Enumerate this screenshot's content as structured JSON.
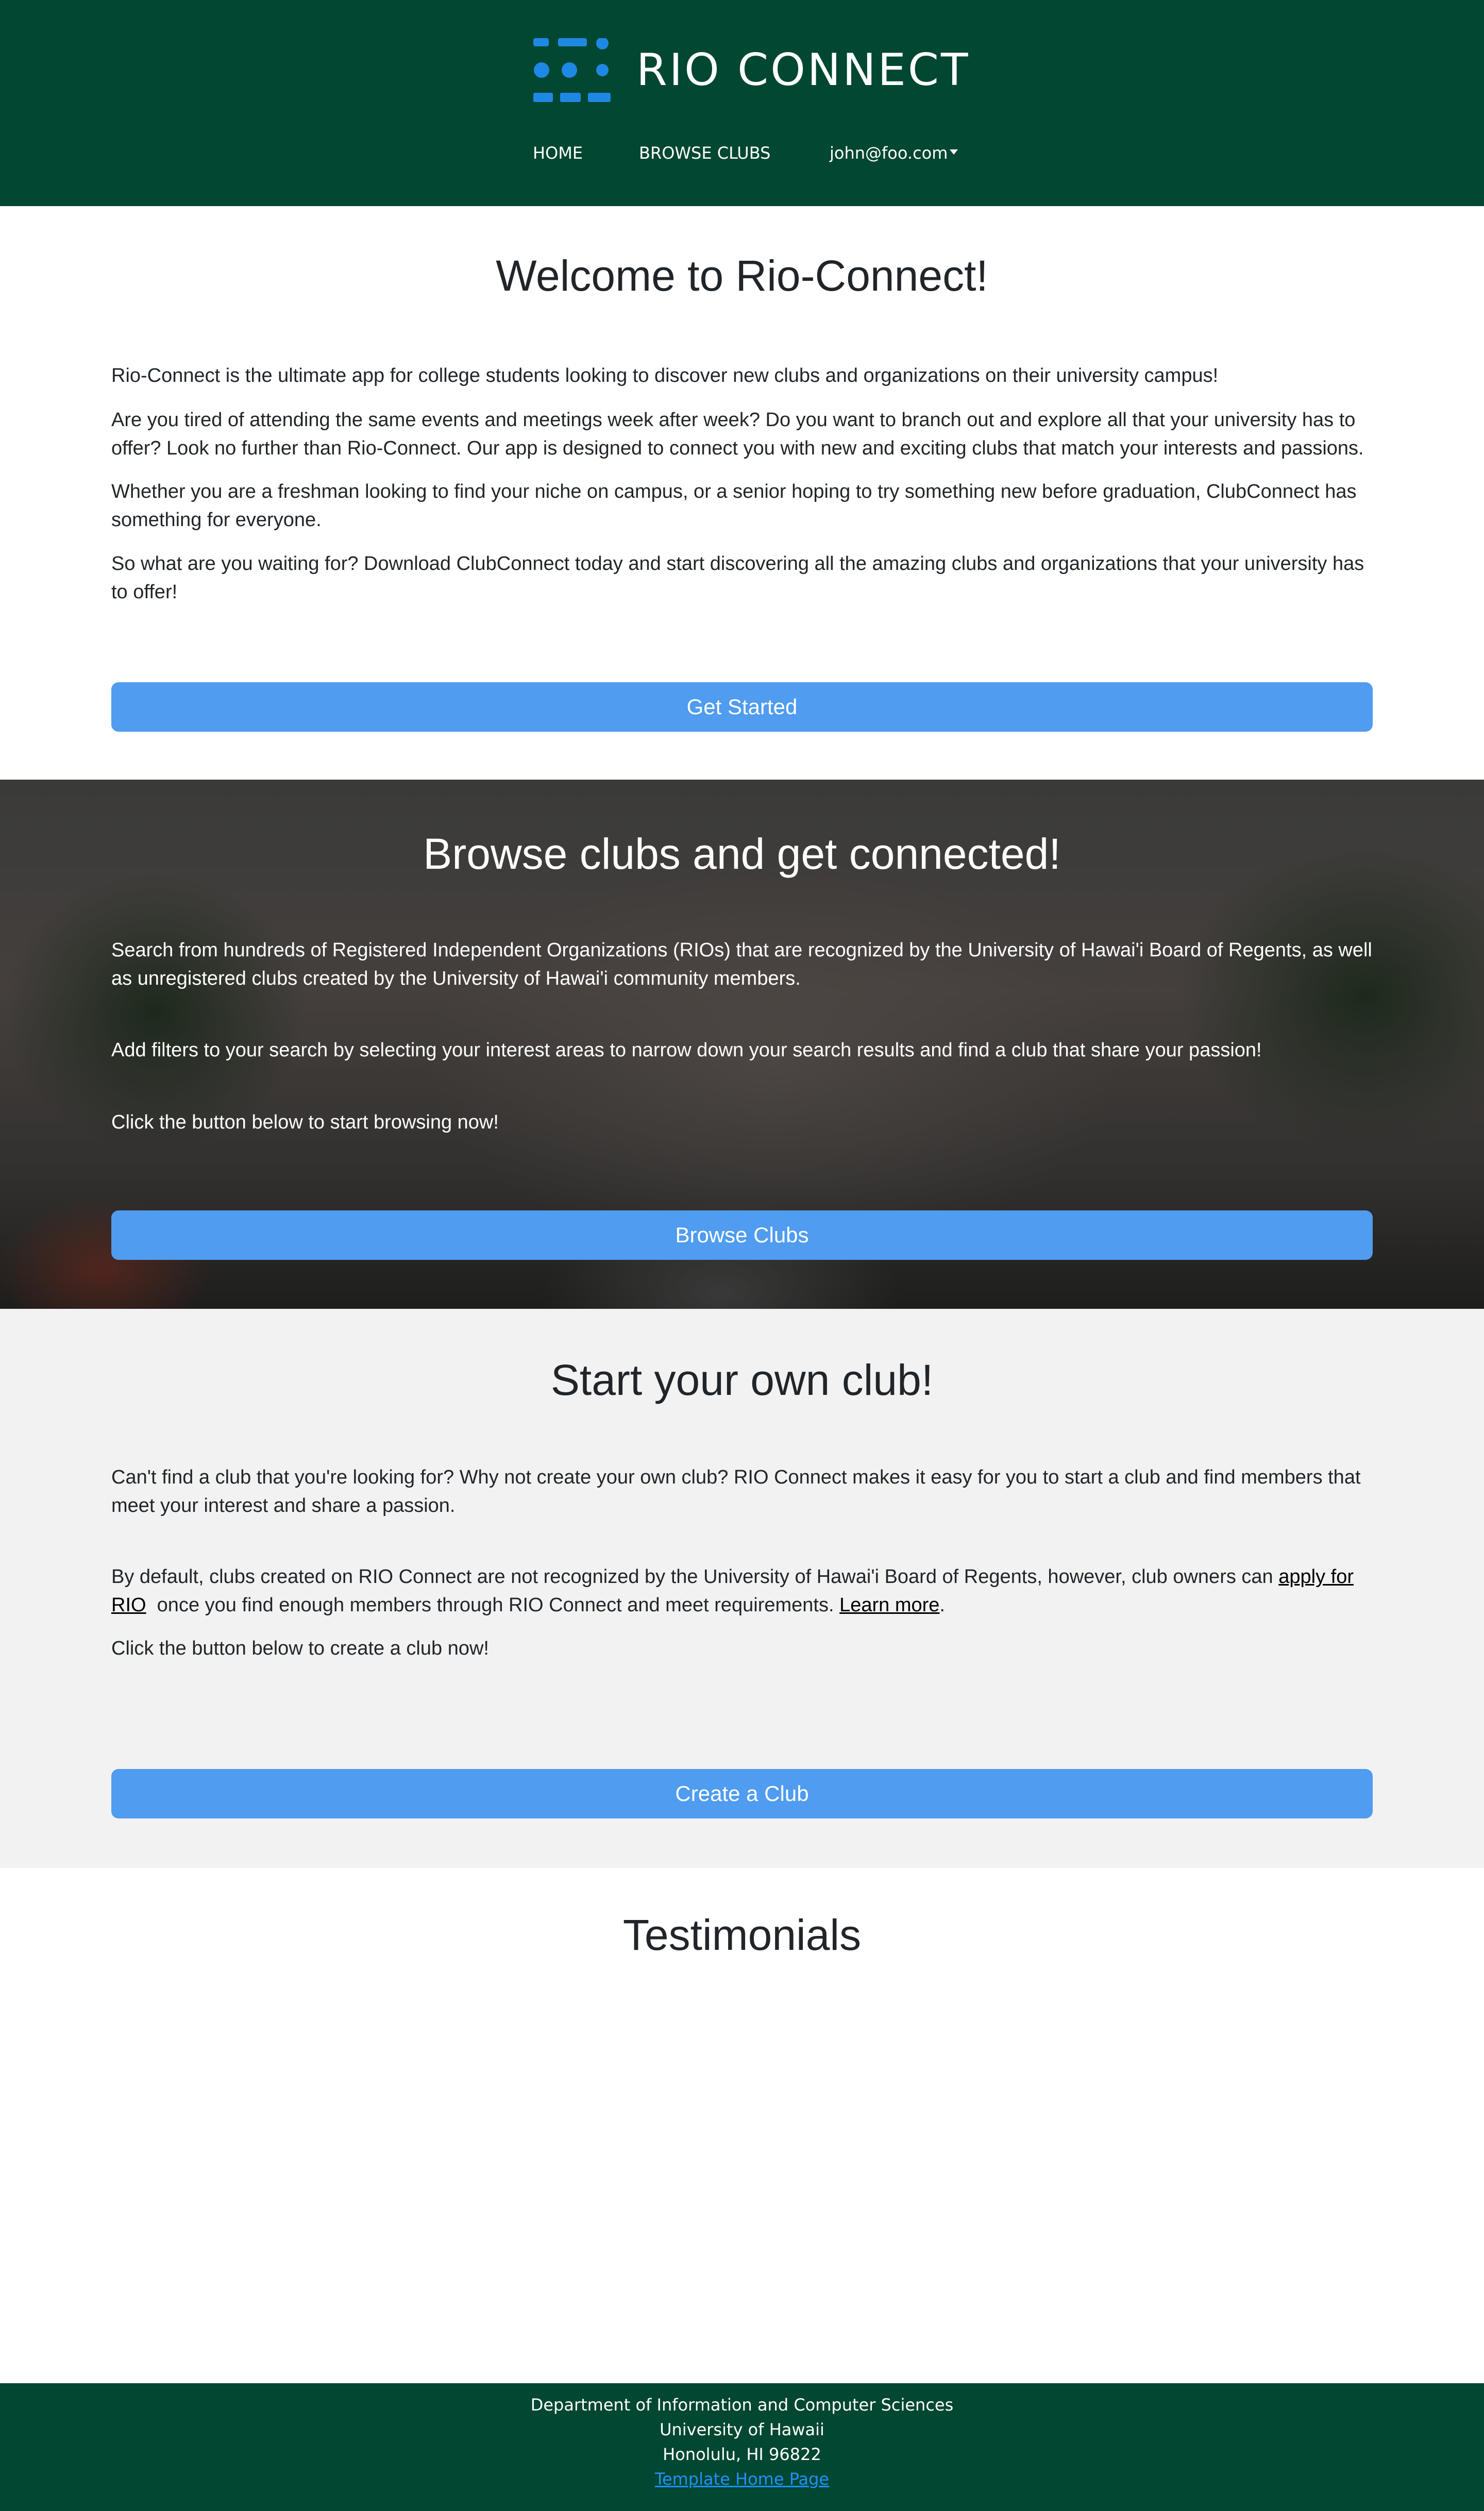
{
  "navbar": {
    "brand": "RIO CONNECT",
    "logo_icon": "rio-connect-logo-icon",
    "links": {
      "home": "HOME",
      "browse": "BROWSE CLUBS",
      "user": "john@foo.com"
    },
    "colors": {
      "background": "#024731",
      "text": "#ffffff",
      "logo": "#1e88e5"
    }
  },
  "welcome": {
    "title": "Welcome to Rio-Connect!",
    "paragraphs": [
      "Rio-Connect is the ultimate app for college students looking to discover new clubs and organizations on their university campus!",
      "Are you tired of attending the same events and meetings week after week? Do you want to branch out and explore all that your university has to offer? Look no further than Rio-Connect. Our app is designed to connect you with new and exciting clubs that match your interests and passions.",
      "Whether you are a freshman looking to find your niche on campus, or a senior hoping to try something new before graduation, ClubConnect has something for everyone.",
      "So what are you waiting for? Download ClubConnect today and start discovering all the amazing clubs and organizations that your university has to offer!"
    ],
    "button": "Get Started"
  },
  "browse": {
    "title": "Browse clubs and get connected!",
    "paragraphs": [
      "Search from hundreds of Registered Independent Organizations (RIOs) that are recognized by the University of Hawai'i Board of Regents, as well as unregistered clubs created by the University of Hawai'i community members.",
      "Add filters to your search by selecting your interest areas to narrow down your search results and find a club that share your passion!",
      "Click the button below to start browsing now!"
    ],
    "button": "Browse Clubs"
  },
  "create": {
    "title": "Start your own club!",
    "paragraph1": "Can't find a club that you're looking for? Why not create your own club? RIO Connect makes it easy for you to start a club and find members that meet your interest and share a passion.",
    "paragraph2": {
      "before": "By default, clubs created on RIO Connect are not recognized by the University of Hawai'i Board of Regents, however, club owners can ",
      "link1": "apply for RIO",
      "middle": "  once you find enough members through RIO Connect and meet requirements. ",
      "link2": "Learn more",
      "after": "."
    },
    "paragraph3": "Click the button below to create a club now!",
    "button": "Create a Club"
  },
  "testimonials": {
    "title": "Testimonials"
  },
  "footer": {
    "lines": [
      "Department of Information and Computer Sciences",
      "University of Hawaii",
      "Honolulu, HI 96822"
    ],
    "link": "Template Home Page"
  },
  "colors": {
    "button": "#4f9cf0",
    "create_bg": "#f2f2f2",
    "footer_link": "#1e90ff"
  }
}
